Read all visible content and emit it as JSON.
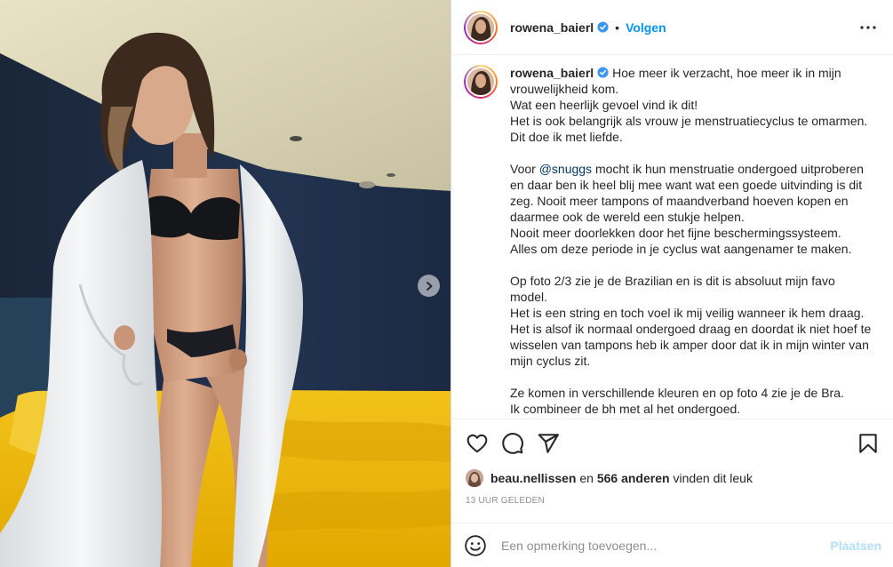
{
  "post": {
    "username": "rowena_baierl",
    "verified": true,
    "separator": "•",
    "follow_label": "Volgen",
    "more_icon": "more-horizontal-icon",
    "next_icon": "chevron-right-icon"
  },
  "caption": {
    "username": "rowena_baierl",
    "paragraphs": [
      [
        "Hoe meer ik verzacht, hoe meer ik in mijn vrouwelijkheid kom.",
        "Wat een heerlijk gevoel vind ik dit!",
        "Het is ook belangrijk als vrouw je menstruatiecyclus te omarmen. Dit doe ik met liefde."
      ],
      [
        "Voor ",
        "@snuggs",
        " mocht ik hun menstruatie ondergoed uitproberen en daar ben ik heel blij mee want wat een goede uitvinding is dit zeg. Nooit meer tampons of maandverband hoeven kopen en daarmee ook de wereld een stukje helpen.",
        "Nooit meer doorlekken door het fijne beschermingssysteem.",
        "Alles om deze periode in je cyclus wat aangenamer te maken."
      ],
      [
        "Op foto 2/3 zie je de Brazilian en is dit is absoluut mijn favo model.",
        "Het is een string en toch voel ik mij veilig wanneer ik hem draag. Het is alsof ik normaal ondergoed draag en doordat ik niet hoef te wisselen van tampons heb ik amper door dat ik in mijn winter van mijn cyclus zit."
      ],
      [
        "Ze komen in verschillende kleuren en op foto 4 zie je de Bra.",
        "Ik combineer de bh met al het ondergoed."
      ]
    ]
  },
  "actions": {
    "like_icon": "heart-icon",
    "comment_icon": "comment-icon",
    "share_icon": "share-icon",
    "save_icon": "bookmark-icon"
  },
  "likes": {
    "first_user": "beau.nellissen",
    "connector": " en ",
    "others": "566 anderen",
    "suffix": " vinden dit leuk"
  },
  "timestamp": "13 UUR GELEDEN",
  "comment": {
    "emoji_icon": "emoji-icon",
    "placeholder": "Een opmerking toevoegen...",
    "value": "",
    "post_label": "Plaatsen"
  },
  "colors": {
    "link": "#0095f6",
    "post_disabled": "#b2dffc",
    "muted": "#8e8e8e",
    "mention": "#00376b",
    "text": "#262626"
  }
}
